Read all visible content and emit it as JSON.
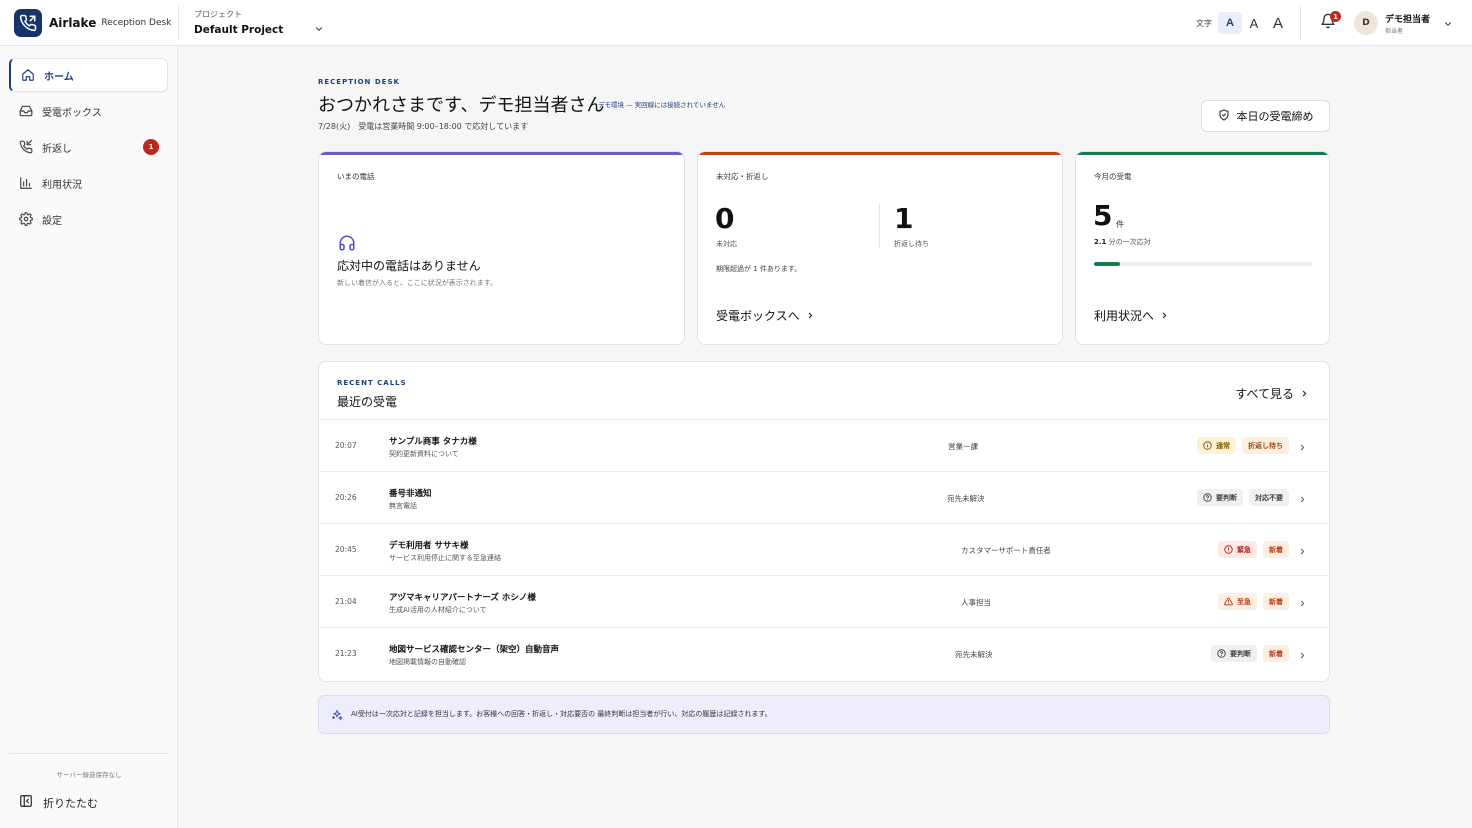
{
  "app": {
    "name": "Airlake",
    "subtitle": "Reception Desk"
  },
  "project": {
    "label": "プロジェクト",
    "name": "Default Project"
  },
  "font_size": {
    "label": "文字",
    "options": [
      "A",
      "A",
      "A"
    ]
  },
  "notifications": {
    "count": "1"
  },
  "user": {
    "initial": "D",
    "name": "デモ担当者",
    "role": "担当者"
  },
  "sidebar": {
    "items": [
      {
        "label": "ホーム",
        "icon": "home-icon"
      },
      {
        "label": "受電ボックス",
        "icon": "inbox-icon"
      },
      {
        "label": "折返し",
        "icon": "phone-callback-icon",
        "badge": "1"
      },
      {
        "label": "利用状況",
        "icon": "bar-chart-icon"
      },
      {
        "label": "設定",
        "icon": "gear-icon"
      }
    ],
    "note": "サーバー録音保存なし",
    "collapse_label": "折りたたむ"
  },
  "header": {
    "eyebrow": "RECEPTION DESK",
    "greeting": "おつかれさまです、デモ担当者さん",
    "env_badge": "デモ環境 — 実回線には接続されていません",
    "subline": "7/28(火)　受電は営業時間 9:00–18:00 で応対しています",
    "close_day_label": "本日の受電締め"
  },
  "cards": {
    "now": {
      "title": "いまの電話",
      "headline": "応対中の電話はありません",
      "sub": "新しい着信が入ると、ここに状況が表示されます。",
      "accent": "#6a5acd"
    },
    "pending": {
      "title": "未対応・折返し",
      "unhandled_value": "0",
      "unhandled_label": "未対応",
      "callback_value": "1",
      "callback_label": "折返し待ち",
      "note": "期限超過が 1 件あります。",
      "link": "受電ボックスへ",
      "accent": "#c2410c"
    },
    "monthly": {
      "title": "今月の受電",
      "value": "5",
      "unit": "件",
      "avg_value": "2.1",
      "avg_label": "分の一次応対",
      "progress": 0.12,
      "link": "利用状況へ",
      "accent": "#167a4a"
    }
  },
  "recent": {
    "eyebrow": "RECENT CALLS",
    "title": "最近の受電",
    "see_all": "すべて見る",
    "rows": [
      {
        "time": "20:07",
        "name": "サンプル商事 タナカ様",
        "desc": "契約更新資料について",
        "dept": "営業一課",
        "priority": "通常",
        "priority_icon": "info-circle-icon",
        "status": "折返し待ち"
      },
      {
        "time": "20:26",
        "name": "番号非通知",
        "desc": "無言電話",
        "dept": "宛先未解決",
        "priority": "要判断",
        "priority_icon": "question-circle-icon",
        "status": "対応不要"
      },
      {
        "time": "20:45",
        "name": "デモ利用者 ササキ様",
        "desc": "サービス利用停止に関する至急連絡",
        "dept": "カスタマーサポート責任者",
        "priority": "緊急",
        "priority_icon": "alert-circle-icon",
        "status": "新着"
      },
      {
        "time": "21:04",
        "name": "アヅマキャリアパートナーズ ホシノ様",
        "desc": "生成AI活用の人材紹介について",
        "dept": "人事担当",
        "priority": "至急",
        "priority_icon": "warning-triangle-icon",
        "status": "新着"
      },
      {
        "time": "21:23",
        "name": "地図サービス確認センター（架空）自動音声",
        "desc": "地図掲載情報の自動確認",
        "dept": "宛先未解決",
        "priority": "要判断",
        "priority_icon": "question-circle-icon",
        "status": "新着"
      }
    ]
  },
  "info": {
    "text": "AI受付は一次応対と記録を担当します。お客様への回答・折返し・対応要否の 最終判断は担当者が行い、対応の履歴は記録されます。"
  }
}
